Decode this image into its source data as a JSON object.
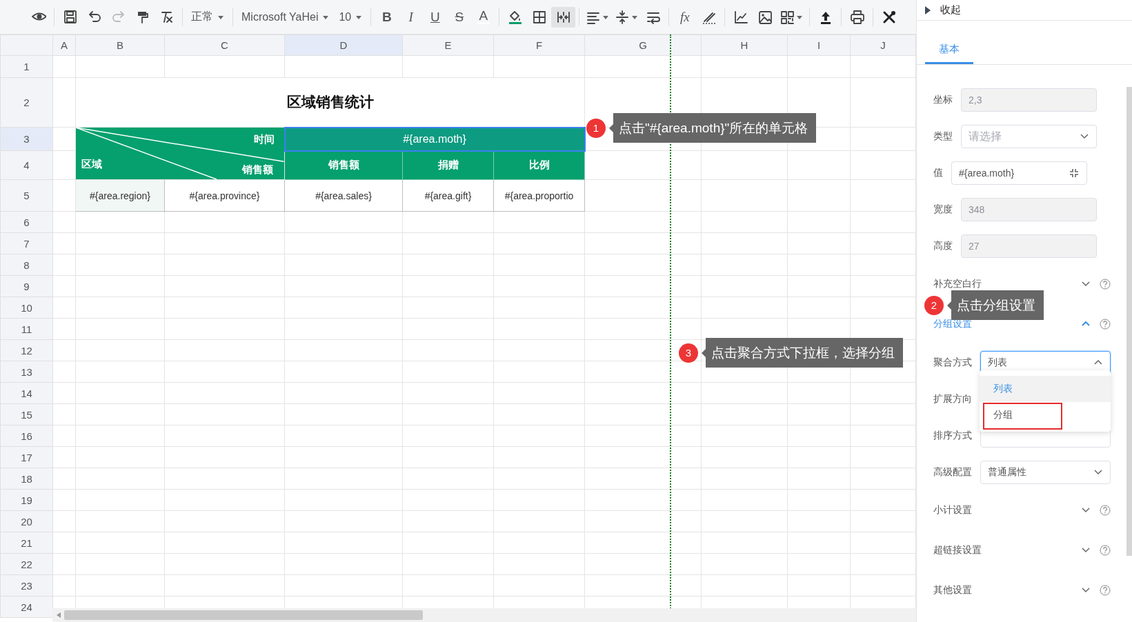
{
  "toolbar": {
    "style": "正常",
    "font": "Microsoft YaHei",
    "size": "10",
    "bold": "B",
    "italic": "I",
    "underline": "U",
    "strike": "S",
    "font_color": "A",
    "formula": "fx",
    "merge_on": true
  },
  "sheet": {
    "columns": [
      {
        "label": "A",
        "selected": false
      },
      {
        "label": "B",
        "selected": false
      },
      {
        "label": "C",
        "selected": false
      },
      {
        "label": "D",
        "selected": true
      },
      {
        "label": "E",
        "selected": false
      },
      {
        "label": "F",
        "selected": false
      },
      {
        "label": "G",
        "selected": false
      },
      {
        "label": "H",
        "selected": false
      },
      {
        "label": "I",
        "selected": false
      },
      {
        "label": "J",
        "selected": false
      }
    ],
    "rows": [
      {
        "label": "1",
        "selected": false
      },
      {
        "label": "2",
        "selected": false
      },
      {
        "label": "3",
        "selected": true
      },
      {
        "label": "4",
        "selected": false
      },
      {
        "label": "5",
        "selected": false
      },
      {
        "label": "6",
        "selected": false
      },
      {
        "label": "7",
        "selected": false
      },
      {
        "label": "8",
        "selected": false
      },
      {
        "label": "9",
        "selected": false
      },
      {
        "label": "10",
        "selected": false
      },
      {
        "label": "11",
        "selected": false
      },
      {
        "label": "12",
        "selected": false
      },
      {
        "label": "13",
        "selected": false
      },
      {
        "label": "14",
        "selected": false
      },
      {
        "label": "15",
        "selected": false
      },
      {
        "label": "16",
        "selected": false
      },
      {
        "label": "17",
        "selected": false
      },
      {
        "label": "18",
        "selected": false
      },
      {
        "label": "19",
        "selected": false
      },
      {
        "label": "20",
        "selected": false
      },
      {
        "label": "21",
        "selected": false
      },
      {
        "label": "22",
        "selected": false
      },
      {
        "label": "23",
        "selected": false
      },
      {
        "label": "24",
        "selected": false
      }
    ],
    "title": "区域销售统计",
    "corner": {
      "top_right": "时间",
      "bottom_right": "销售额",
      "bottom_left": "区域"
    },
    "month_cell": {
      "text": "#{area.moth}",
      "selected": true
    },
    "headers": [
      "销售额",
      "捐赠",
      "比例"
    ],
    "data": [
      "#{area.region}",
      "#{area.province}",
      "#{area.sales}",
      "#{area.gift}",
      "#{area.proportio"
    ]
  },
  "panel": {
    "collapse_label": "收起",
    "tabs": [
      {
        "label": "基本",
        "selected": true
      }
    ],
    "fields": [
      {
        "kind": "input",
        "label": "坐标",
        "value": "2,3",
        "disabled": true
      },
      {
        "kind": "select",
        "label": "类型",
        "placeholder": "请选择",
        "open": false
      },
      {
        "kind": "expression",
        "label": "值",
        "value": "#{area.moth}"
      },
      {
        "kind": "input",
        "label": "宽度",
        "value": "348",
        "disabled": true
      },
      {
        "kind": "input",
        "label": "高度",
        "value": "27",
        "disabled": true
      },
      {
        "kind": "section",
        "label": "补充空白行",
        "expanded": false,
        "active": false
      },
      {
        "kind": "section",
        "label": "分组设置",
        "expanded": true,
        "active": true
      },
      {
        "kind": "select",
        "label": "聚合方式",
        "value": "列表",
        "open": true
      },
      {
        "kind": "label",
        "label": "扩展方向"
      },
      {
        "kind": "select",
        "label": "排序方式",
        "open": false
      },
      {
        "kind": "select",
        "label": "高级配置",
        "value": "普通属性",
        "open": false
      },
      {
        "kind": "section",
        "label": "小计设置",
        "expanded": false,
        "active": false
      },
      {
        "kind": "section",
        "label": "超链接设置",
        "expanded": false,
        "active": false
      },
      {
        "kind": "section",
        "label": "其他设置",
        "expanded": false,
        "active": false
      }
    ],
    "dropdown": [
      {
        "label": "列表",
        "selected": true,
        "highlighted": false
      },
      {
        "label": "分组",
        "selected": false,
        "highlighted": true
      }
    ]
  },
  "callouts": [
    {
      "number": "1",
      "text": "点击\"#{area.moth}\"所在的单元格"
    },
    {
      "number": "2",
      "text": "点击分组设置"
    },
    {
      "number": "3",
      "text": "点击聚合方式下拉框，选择分组"
    }
  ]
}
